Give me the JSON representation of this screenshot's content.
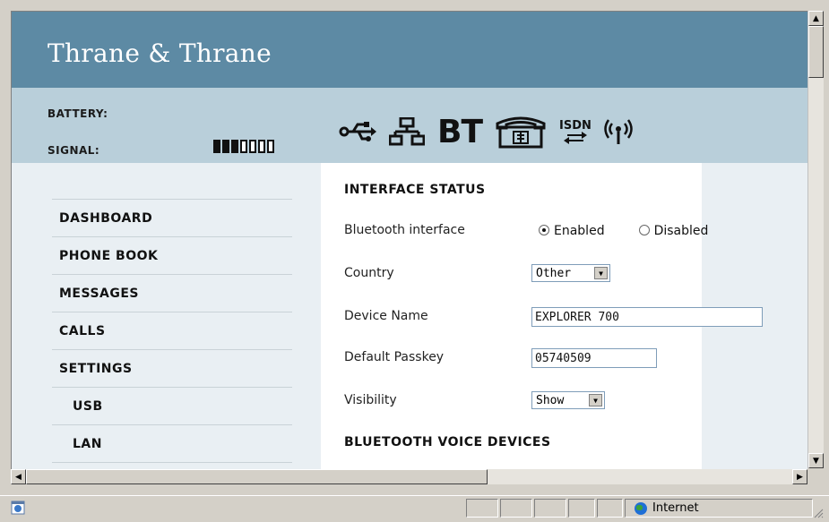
{
  "brand": {
    "logo_text": "Thrane & Thrane",
    "header_color": "#5d8aa4",
    "status_color": "#b9cfda"
  },
  "status": {
    "battery_label": "BATTERY:",
    "signal_label": "SIGNAL:",
    "signal_level": {
      "filled": 3,
      "total": 7
    }
  },
  "interface_icons": [
    "usb-icon",
    "lan-icon",
    "bluetooth-icon",
    "phone-icon",
    "isdn-icon",
    "wlan-icon"
  ],
  "isdn_icon_label": "ISDN",
  "bt_icon_label": "BT",
  "nav": {
    "items": [
      {
        "label": "DASHBOARD",
        "sub": false
      },
      {
        "label": "PHONE BOOK",
        "sub": false
      },
      {
        "label": "MESSAGES",
        "sub": false
      },
      {
        "label": "CALLS",
        "sub": false
      },
      {
        "label": "SETTINGS",
        "sub": false
      },
      {
        "label": "USB",
        "sub": true
      },
      {
        "label": "LAN",
        "sub": true
      }
    ]
  },
  "form": {
    "section_title": "INTERFACE STATUS",
    "bluetooth_label": "Bluetooth interface",
    "enabled_label": "Enabled",
    "disabled_label": "Disabled",
    "bluetooth_selected": "Enabled",
    "country_label": "Country",
    "country_value": "Other",
    "device_name_label": "Device Name",
    "device_name_value": "EXPLORER 700",
    "passkey_label": "Default Passkey",
    "passkey_value": "05740509",
    "visibility_label": "Visibility",
    "visibility_value": "Show",
    "section2_title": "BLUETOOTH VOICE DEVICES"
  },
  "statusbar": {
    "zone_label": "Internet"
  }
}
